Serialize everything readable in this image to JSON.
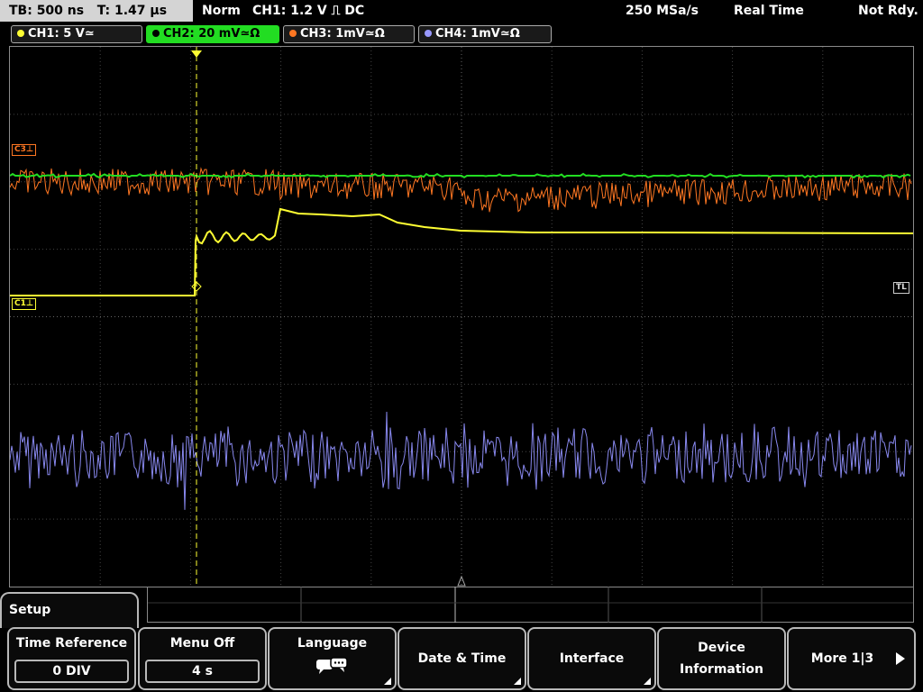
{
  "topbar": {
    "timebase": "TB: 500 ns   T: 1.47 µs",
    "mode": "Norm",
    "trigger": "CH1: 1.2 V ⎍ DC",
    "sample_rate": "250 MSa/s",
    "acq_mode": "Real Time",
    "status": "Not Rdy."
  },
  "channels": [
    {
      "label": "CH1: 5 V≃",
      "color": "#ffff33"
    },
    {
      "label": "CH2: 20 mV≃Ω",
      "color": "#22dd22"
    },
    {
      "label": "CH3: 1mV≃Ω",
      "color": "#ff7722"
    },
    {
      "label": "CH4: 1mV≃Ω",
      "color": "#9999ff"
    }
  ],
  "markers": {
    "c3": "C3⊥",
    "c1": "C1⊥",
    "tl": "TL"
  },
  "menu": {
    "title": "Setup",
    "softkeys": [
      {
        "label": "Time Reference",
        "value": "0 DIV"
      },
      {
        "label": "Menu Off",
        "value": "4 s"
      },
      {
        "label": "Language",
        "icon": "speech-bubbles-icon"
      },
      {
        "label": "Date & Time"
      },
      {
        "label": "Interface"
      },
      {
        "label": "Device Information"
      },
      {
        "label": "More 1|3",
        "icon": "arrow-right-icon"
      }
    ]
  }
}
